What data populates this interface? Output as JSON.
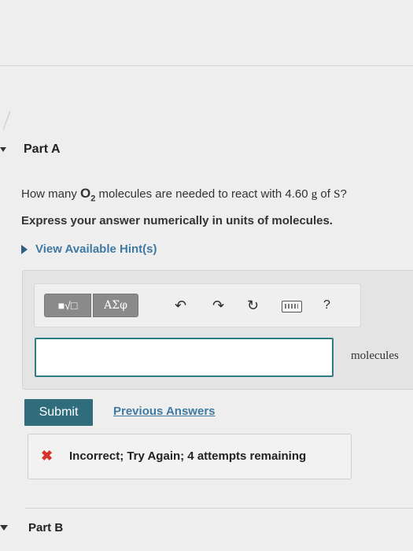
{
  "part_a": {
    "label": "Part A"
  },
  "question": {
    "prefix": "How many ",
    "molecule_main": "O",
    "molecule_sub": "2",
    "middle": " molecules are needed to react with ",
    "mass": "4.60",
    "unit": "g",
    "of": " of ",
    "element": "S",
    "end": "?"
  },
  "instruction": "Express your answer numerically in units of molecules.",
  "hint": {
    "label": "View Available Hint(s)"
  },
  "toolbar": {
    "templates_label": "■√□",
    "greek_label": "ΑΣφ",
    "undo_icon": "↶",
    "redo_icon": "↷",
    "reset_icon": "↻",
    "help_label": "?"
  },
  "answer": {
    "value": "",
    "units": "molecules"
  },
  "submit_label": "Submit",
  "previous_answers_label": "Previous Answers",
  "feedback": {
    "icon": "✖",
    "message": "Incorrect; Try Again; 4 attempts remaining"
  },
  "part_b": {
    "label": "Part B"
  }
}
